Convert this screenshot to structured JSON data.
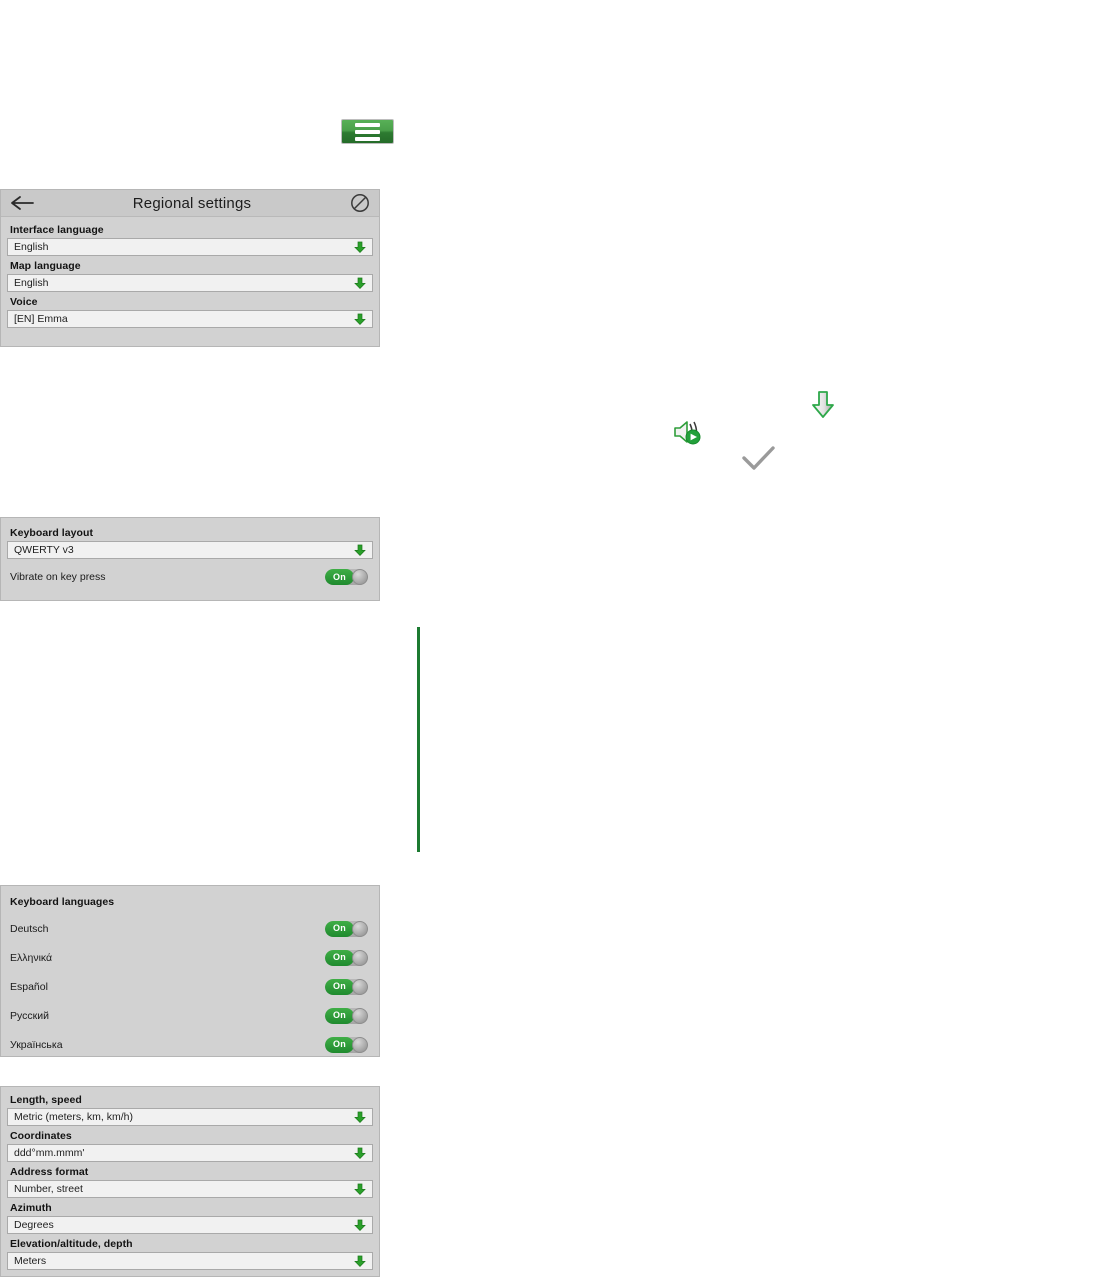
{
  "toolbar": {
    "menu_button": {
      "name": "hamburger-menu-button",
      "icon": "hamburger-icon"
    }
  },
  "regional_panel": {
    "titlebar": {
      "back_icon": "back-arrow-icon",
      "title": "Regional settings",
      "right_icon": "no-entry-icon"
    },
    "fields": [
      {
        "label": "Interface language",
        "value": "English",
        "icon": "chevron-down-icon"
      },
      {
        "label": "Map language",
        "value": "English",
        "icon": "chevron-down-icon"
      },
      {
        "label": "Voice",
        "value": "[EN] Emma",
        "icon": "chevron-down-icon"
      }
    ]
  },
  "keyboard_panel": {
    "field": {
      "label": "Keyboard layout",
      "value": "QWERTY v3",
      "icon": "chevron-down-icon"
    },
    "toggle": {
      "label": "Vibrate on key press",
      "state": "On"
    }
  },
  "keyboard_languages_panel": {
    "heading": "Keyboard languages",
    "items": [
      {
        "label": "Deutsch",
        "state": "On"
      },
      {
        "label": "Ελληνικά",
        "state": "On"
      },
      {
        "label": "Español",
        "state": "On"
      },
      {
        "label": "Русский",
        "state": "On"
      },
      {
        "label": "Українська",
        "state": "On"
      }
    ]
  },
  "units_panel": {
    "fields": [
      {
        "label": "Length, speed",
        "value": "Metric (meters, km, km/h)",
        "icon": "chevron-down-icon"
      },
      {
        "label": "Coordinates",
        "value": "ddd°mm.mmm'",
        "icon": "chevron-down-icon"
      },
      {
        "label": "Address format",
        "value": "Number, street",
        "icon": "chevron-down-icon"
      },
      {
        "label": "Azimuth",
        "value": "Degrees",
        "icon": "chevron-down-icon"
      },
      {
        "label": "Elevation/altitude, depth",
        "value": "Meters",
        "icon": "chevron-down-icon"
      }
    ]
  },
  "floating_icons": [
    {
      "name": "download-arrow-icon"
    },
    {
      "name": "speaker-play-icon"
    },
    {
      "name": "checkmark-icon"
    }
  ],
  "divider": {
    "name": "green-vertical-divider"
  },
  "colors": {
    "accent_green": "#1f8a2e",
    "button_green": "#3c9a3f",
    "panel_gray": "#d2d2d2",
    "titlebar_gray": "#c9c9c9",
    "field_bg": "#f1f1f1",
    "knob_gray": "#a6a6a6"
  }
}
